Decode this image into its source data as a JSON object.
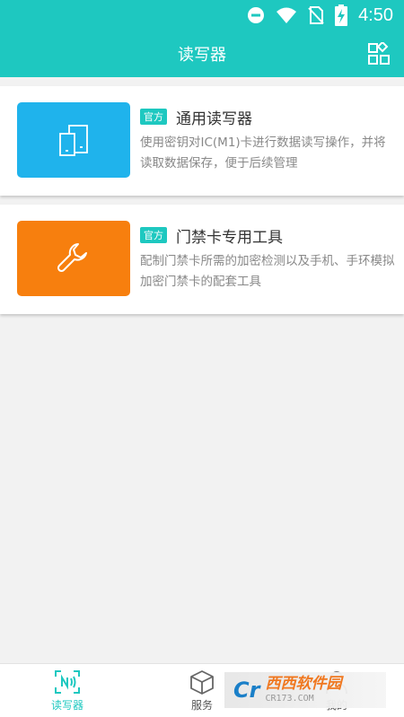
{
  "status_bar": {
    "time": "4:50",
    "icons": [
      "dnd-icon",
      "wifi-icon",
      "no-sim-icon",
      "battery-charging-icon"
    ]
  },
  "app_bar": {
    "title": "读写器",
    "action_icon": "apps-grid-icon"
  },
  "cards": [
    {
      "tag": "官方",
      "title": "通用读写器",
      "description": "使用密钥对IC(M1)卡进行数据读写操作，并将读取数据保存，便于后续管理",
      "icon": "card-reader-icon",
      "color": "#1fb3ec"
    },
    {
      "tag": "官方",
      "title": "门禁卡专用工具",
      "description": "配制门禁卡所需的加密检测以及手机、手环模拟加密门禁卡的配套工具",
      "icon": "wrench-icon",
      "color": "#f77f0e"
    }
  ],
  "tabs": [
    {
      "label": "读写器",
      "icon": "nfc-icon",
      "active": true
    },
    {
      "label": "服务",
      "icon": "cube-icon",
      "active": false
    },
    {
      "label": "我的",
      "icon": "person-icon",
      "active": false
    }
  ],
  "watermark": {
    "logo": "Cr",
    "text": "西西软件园",
    "sub": "CR173.COM"
  },
  "colors": {
    "accent": "#1ec8c0",
    "blue": "#1fb3ec",
    "orange": "#f77f0e"
  }
}
